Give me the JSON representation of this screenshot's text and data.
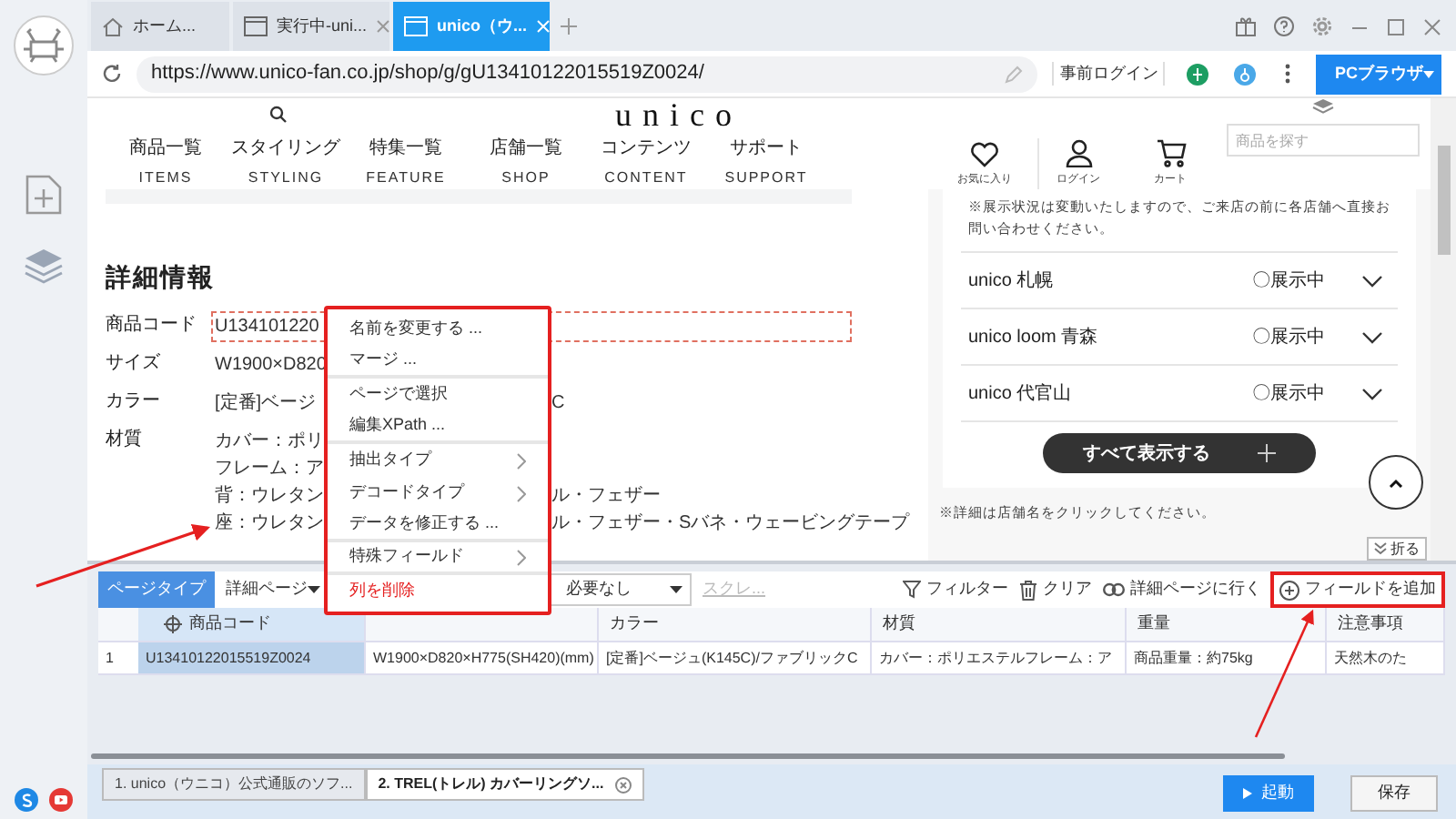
{
  "browser_tabs": [
    {
      "label": "ホーム...",
      "selected": false,
      "kind": "home"
    },
    {
      "label": "実行中-uni...",
      "selected": false,
      "kind": "page"
    },
    {
      "label": "unico（ウ...",
      "selected": true,
      "kind": "page"
    }
  ],
  "address_bar": {
    "url": "https://www.unico-fan.co.jp/shop/g/gU13410122015519Z0024/"
  },
  "browser_actions": {
    "pre_login": "事前ログイン",
    "mode": "PCブラウザ"
  },
  "site": {
    "logo": "unico",
    "nav": [
      {
        "ja": "商品一覧",
        "en": "ITEMS"
      },
      {
        "ja": "スタイリング",
        "en": "STYLING"
      },
      {
        "ja": "特集一覧",
        "en": "FEATURE"
      },
      {
        "ja": "店舗一覧",
        "en": "SHOP"
      },
      {
        "ja": "コンテンツ",
        "en": "CONTENT"
      },
      {
        "ja": "サポート",
        "en": "SUPPORT"
      }
    ],
    "actions": [
      {
        "label": "お気に入り",
        "kind": "heart"
      },
      {
        "label": "ログイン",
        "kind": "user"
      },
      {
        "label": "カート",
        "kind": "cart"
      }
    ],
    "search": {
      "placeholder": "商品を探す"
    }
  },
  "detail": {
    "heading": "詳細情報",
    "rows": [
      {
        "label": "商品コード",
        "selected": true,
        "lines": [
          {
            "left": "U134101220"
          }
        ]
      },
      {
        "label": "サイズ",
        "selected": false,
        "lines": [
          {
            "left": "W1900×D820"
          }
        ]
      },
      {
        "label": "カラー",
        "selected": false,
        "lines": [
          {
            "left": "[定番]ベージ",
            "right": "C"
          }
        ]
      },
      {
        "label": "材質",
        "selected": false,
        "lines": [
          {
            "left": "カバー：ポリ"
          },
          {
            "left": "フレーム：ア"
          },
          {
            "left": "背：ウレタン",
            "right": "ル・フェザー"
          },
          {
            "left": "座：ウレタン",
            "right": "ル・フェザー・Sバネ・ウェービングテープ"
          }
        ]
      }
    ]
  },
  "stores": {
    "notice": "※展示状況は変動いたしますので、ご来店の前に各店舗へ直接お問い合わせください。",
    "items": [
      {
        "name": "unico 札幌",
        "status": "〇展示中"
      },
      {
        "name": "unico loom 青森",
        "status": "〇展示中"
      },
      {
        "name": "unico 代官山",
        "status": "〇展示中"
      }
    ],
    "show_all": "すべて表示する",
    "footnote": "※詳細は店舗名をクリックしてください。"
  },
  "collapse_button": "折る",
  "context_menu": {
    "items": [
      {
        "label": "名前を変更する ...",
        "submenu": false,
        "danger": false,
        "separator_after": false
      },
      {
        "label": "マージ ...",
        "submenu": false,
        "danger": false,
        "separator_after": true
      },
      {
        "label": "ページで選択",
        "submenu": false,
        "danger": false,
        "separator_after": false
      },
      {
        "label": "編集XPath ...",
        "submenu": false,
        "danger": false,
        "separator_after": true
      },
      {
        "label": "抽出タイプ",
        "submenu": true,
        "danger": false,
        "separator_after": false
      },
      {
        "label": "デコードタイプ",
        "submenu": true,
        "danger": false,
        "separator_after": false
      },
      {
        "label": "データを修正する ...",
        "submenu": false,
        "danger": false,
        "separator_after": true
      },
      {
        "label": "特殊フィールド",
        "submenu": true,
        "danger": false,
        "separator_after": true
      },
      {
        "label": "列を削除",
        "submenu": false,
        "danger": true,
        "separator_after": false
      }
    ]
  },
  "extract_toolbar": {
    "page_type_label": "ページタイプ",
    "page_type": "詳細ページ",
    "option": "必要なし",
    "scroll_link": "スクレ...",
    "actions": [
      {
        "label": "フィルター",
        "kind": "filter",
        "highlighted": false
      },
      {
        "label": "クリア",
        "kind": "trash",
        "highlighted": false
      },
      {
        "label": "詳細ページに行く",
        "kind": "link",
        "highlighted": false
      },
      {
        "label": "フィールドを追加",
        "kind": "add",
        "highlighted": true
      }
    ]
  },
  "table": {
    "columns": [
      {
        "label": "商品コード",
        "selected": true
      },
      {
        "selected": false
      },
      {
        "label": "カラー",
        "selected": false
      },
      {
        "label": "材質",
        "selected": false
      },
      {
        "label": "重量",
        "selected": false
      },
      {
        "label": "注意事項",
        "selected": false
      }
    ],
    "rows": [
      {
        "index": "1",
        "cells": [
          "U13410122015519Z0024",
          "W1900×D820×H775(SH420)(mm)",
          "[定番]ベージュ(K145C)/ファブリックC",
          "カバー：ポリエステルフレーム：ア",
          "商品重量：約75kg",
          "天然木のた"
        ]
      }
    ]
  },
  "task_tabs": [
    {
      "label": "1. unico（ウニコ）公式通販のソフ...",
      "selected": false
    },
    {
      "label": "2. TREL(トレル) カバーリングソ...",
      "selected": true
    }
  ],
  "run_button": "起動",
  "save_button": "保存"
}
